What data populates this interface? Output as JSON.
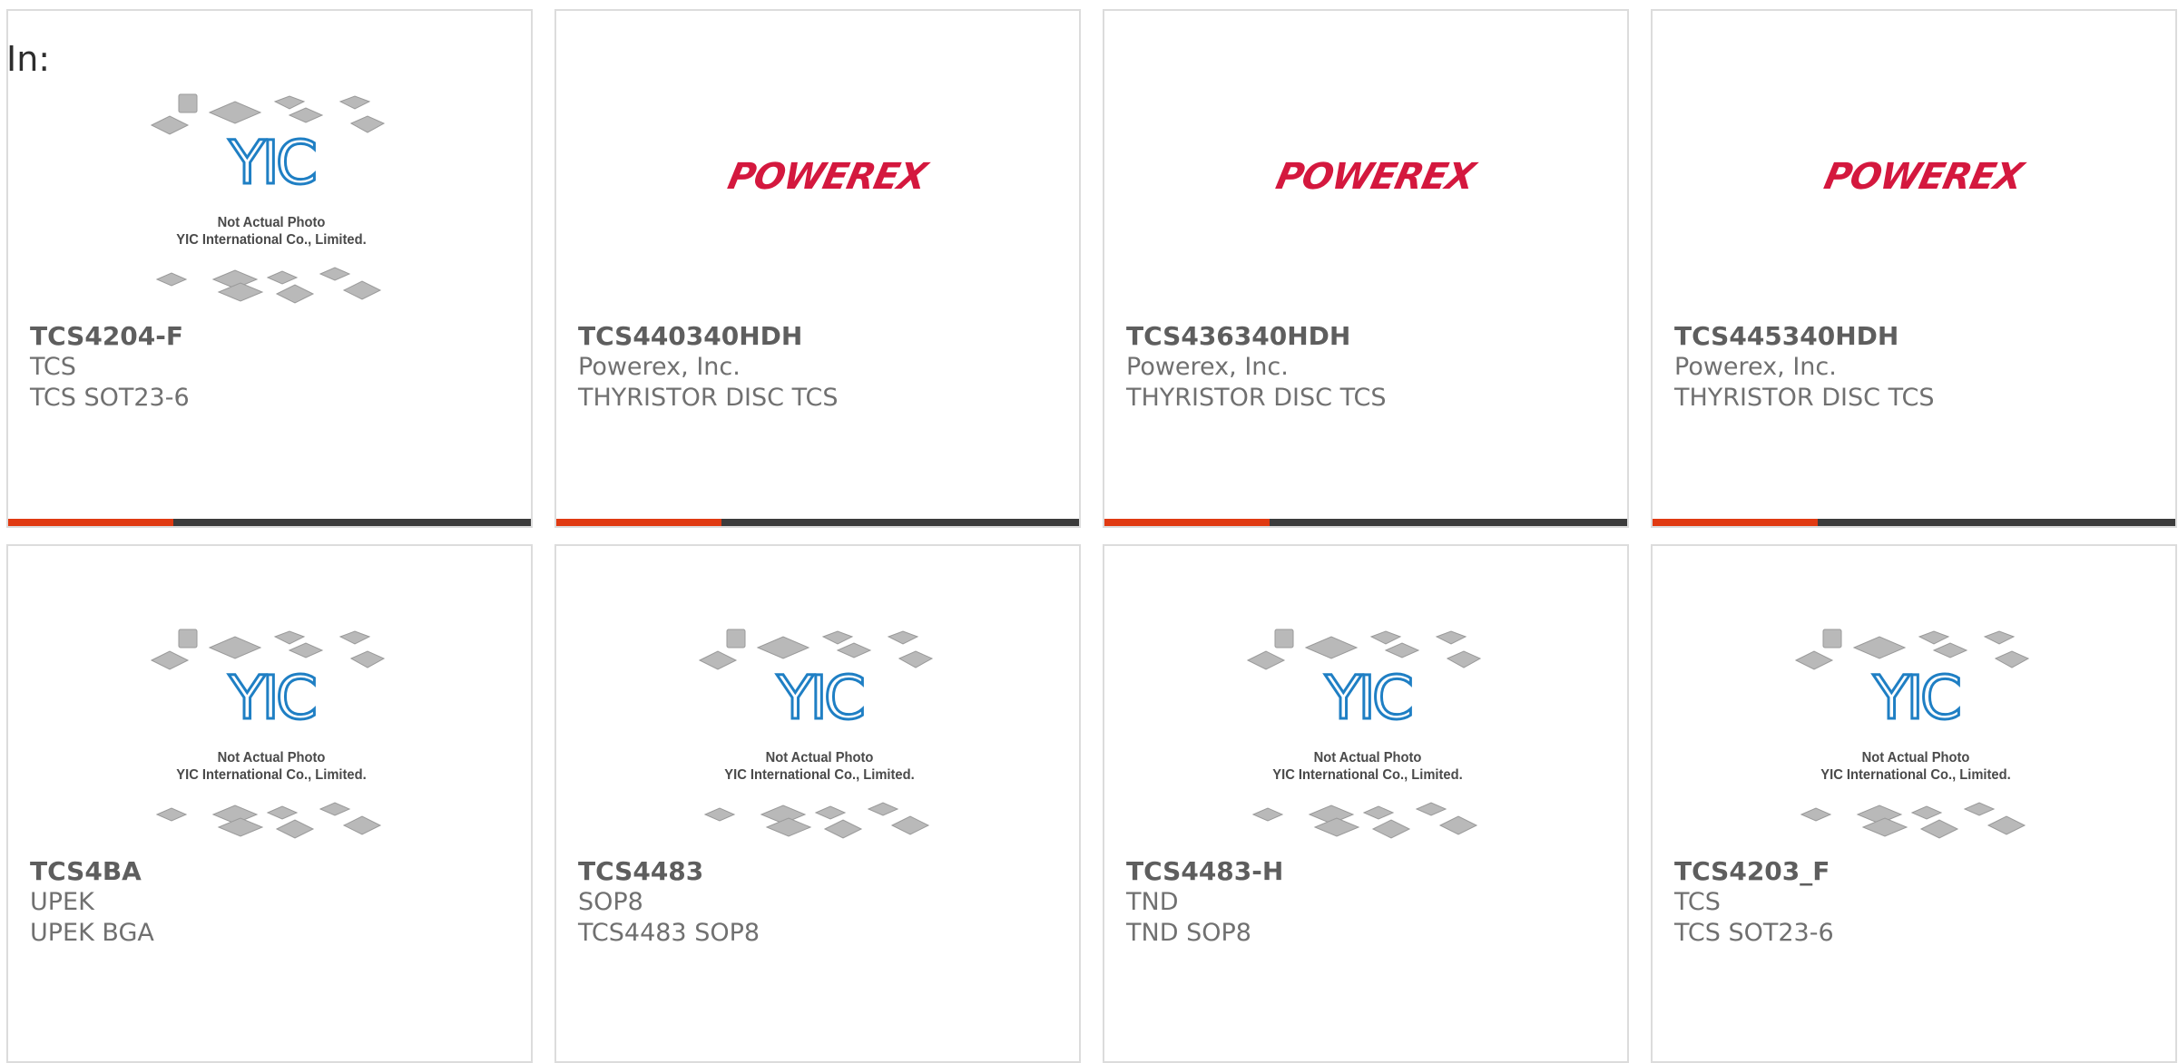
{
  "filter": {
    "label": "In:"
  },
  "placeholder": {
    "line1": "Not Actual Photo",
    "line2": "YIC International Co., Limited."
  },
  "logos": {
    "powerex": "POWEREX"
  },
  "colors": {
    "accent": "#e03a12",
    "bar": "#3c3c3c",
    "powerex": "#d4183e",
    "yic_blue": "#1f7fc4"
  },
  "products": [
    {
      "part": "TCS4204-F",
      "maker": "TCS",
      "desc": "TCS SOT23-6",
      "image": "placeholder-photo"
    },
    {
      "part": "TCS440340HDH",
      "maker": "Powerex, Inc.",
      "desc": "THYRISTOR DISC TCS",
      "image": "powerex-logo"
    },
    {
      "part": "TCS436340HDH",
      "maker": "Powerex, Inc.",
      "desc": "THYRISTOR DISC TCS",
      "image": "powerex-logo"
    },
    {
      "part": "TCS445340HDH",
      "maker": "Powerex, Inc.",
      "desc": "THYRISTOR DISC TCS",
      "image": "powerex-logo"
    },
    {
      "part": "TCS4BA",
      "maker": "UPEK",
      "desc": "UPEK BGA",
      "image": "placeholder-photo"
    },
    {
      "part": "TCS4483",
      "maker": "SOP8",
      "desc": "TCS4483 SOP8",
      "image": "placeholder-photo"
    },
    {
      "part": "TCS4483-H",
      "maker": "TND",
      "desc": "TND SOP8",
      "image": "placeholder-photo"
    },
    {
      "part": "TCS4203_F",
      "maker": "TCS",
      "desc": "TCS SOT23-6",
      "image": "placeholder-photo"
    }
  ]
}
